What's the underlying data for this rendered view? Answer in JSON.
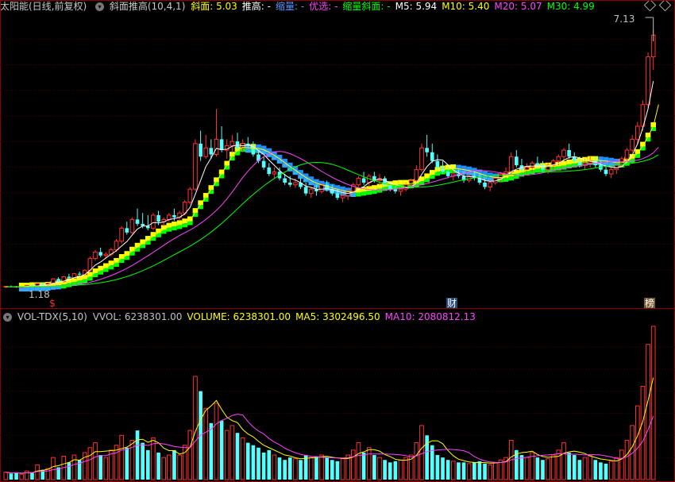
{
  "header": {
    "stock": "太阳能(日线,前复权)",
    "indicator": "斜面推高(10,4,1)",
    "items": [
      {
        "label": "斜面:",
        "value": "5.03",
        "color": "#ffff00"
      },
      {
        "label": "推高:",
        "value": "-",
        "color": "#ffffff"
      },
      {
        "label": "缩量:",
        "value": "-",
        "color": "#5599ff"
      },
      {
        "label": "优选:",
        "value": "-",
        "color": "#ff44ff"
      },
      {
        "label": "缩量斜面:",
        "value": "-",
        "color": "#00ff00"
      },
      {
        "label": "M5:",
        "value": "5.94",
        "color": "#ffffff"
      },
      {
        "label": "M10:",
        "value": "5.40",
        "color": "#ffff00"
      },
      {
        "label": "M20:",
        "value": "5.07",
        "color": "#ff44ff"
      },
      {
        "label": "M30:",
        "value": "4.99",
        "color": "#00ff00"
      }
    ]
  },
  "vol_header": {
    "name": "VOL-TDX(5,10)",
    "items": [
      {
        "label": "VVOL:",
        "value": "6238301.00",
        "color": "#c0c0c0"
      },
      {
        "label": "VOLUME:",
        "value": "6238301.00",
        "color": "#ffff00"
      },
      {
        "label": "MA5:",
        "value": "3302496.50",
        "color": "#ffff00"
      },
      {
        "label": "MA10:",
        "value": "2080812.13",
        "color": "#ff44ff"
      }
    ]
  },
  "markers": {
    "high_label": "7.13",
    "low_label": "1.18",
    "event_marks": [
      "$",
      "财",
      "榜"
    ]
  },
  "chart_data": {
    "type": "candlestick",
    "price_range": [
      1.0,
      7.5
    ],
    "candles": [
      [
        1.2,
        1.22,
        1.17,
        1.21
      ],
      [
        1.21,
        1.23,
        1.19,
        1.2
      ],
      [
        1.2,
        1.22,
        1.18,
        1.19
      ],
      [
        1.19,
        1.21,
        1.18,
        1.2
      ],
      [
        1.2,
        1.24,
        1.19,
        1.23
      ],
      [
        1.23,
        1.25,
        1.2,
        1.21
      ],
      [
        1.21,
        1.28,
        1.2,
        1.27
      ],
      [
        1.27,
        1.3,
        1.24,
        1.25
      ],
      [
        1.25,
        1.3,
        1.22,
        1.28
      ],
      [
        1.28,
        1.4,
        1.27,
        1.38
      ],
      [
        1.38,
        1.42,
        1.3,
        1.32
      ],
      [
        1.32,
        1.45,
        1.3,
        1.43
      ],
      [
        1.43,
        1.5,
        1.38,
        1.4
      ],
      [
        1.4,
        1.52,
        1.39,
        1.5
      ],
      [
        1.5,
        1.55,
        1.45,
        1.48
      ],
      [
        1.48,
        1.6,
        1.46,
        1.58
      ],
      [
        1.58,
        1.9,
        1.55,
        1.85
      ],
      [
        1.85,
        2.05,
        1.8,
        2.0
      ],
      [
        2.0,
        2.1,
        1.88,
        1.92
      ],
      [
        1.92,
        2.0,
        1.85,
        1.95
      ],
      [
        1.95,
        2.1,
        1.9,
        2.05
      ],
      [
        2.05,
        2.3,
        2.0,
        2.25
      ],
      [
        2.25,
        2.6,
        2.2,
        2.55
      ],
      [
        2.55,
        2.7,
        2.4,
        2.45
      ],
      [
        2.45,
        2.8,
        2.42,
        2.75
      ],
      [
        2.75,
        3.0,
        2.6,
        2.65
      ],
      [
        2.65,
        2.9,
        2.55,
        2.6
      ],
      [
        2.6,
        2.85,
        2.5,
        2.55
      ],
      [
        2.55,
        2.9,
        2.5,
        2.85
      ],
      [
        2.85,
        2.95,
        2.62,
        2.7
      ],
      [
        2.7,
        2.8,
        2.6,
        2.75
      ],
      [
        2.75,
        2.9,
        2.7,
        2.85
      ],
      [
        2.85,
        3.0,
        2.72,
        2.8
      ],
      [
        2.8,
        2.95,
        2.75,
        2.9
      ],
      [
        2.9,
        3.2,
        2.85,
        3.15
      ],
      [
        3.15,
        3.5,
        3.1,
        3.45
      ],
      [
        3.45,
        4.6,
        3.4,
        4.5
      ],
      [
        4.5,
        4.8,
        4.1,
        4.2
      ],
      [
        4.2,
        4.7,
        4.15,
        4.4
      ],
      [
        4.4,
        4.6,
        4.15,
        4.25
      ],
      [
        4.25,
        5.3,
        4.2,
        4.6
      ],
      [
        4.6,
        4.9,
        4.3,
        4.35
      ],
      [
        4.35,
        4.6,
        4.15,
        4.45
      ],
      [
        4.45,
        4.7,
        4.3,
        4.55
      ],
      [
        4.55,
        4.75,
        4.35,
        4.4
      ],
      [
        4.4,
        4.6,
        4.3,
        4.5
      ],
      [
        4.5,
        4.65,
        4.4,
        4.45
      ],
      [
        4.45,
        4.55,
        4.2,
        4.25
      ],
      [
        4.25,
        4.35,
        4.05,
        4.1
      ],
      [
        4.1,
        4.2,
        3.9,
        3.95
      ],
      [
        3.95,
        4.05,
        3.75,
        3.8
      ],
      [
        3.8,
        3.95,
        3.7,
        3.85
      ],
      [
        3.85,
        3.95,
        3.65,
        3.7
      ],
      [
        3.7,
        3.8,
        3.55,
        3.6
      ],
      [
        3.6,
        3.75,
        3.5,
        3.55
      ],
      [
        3.55,
        3.7,
        3.48,
        3.6
      ],
      [
        3.6,
        3.7,
        3.45,
        3.5
      ],
      [
        3.5,
        3.6,
        3.3,
        3.35
      ],
      [
        3.35,
        3.5,
        3.25,
        3.45
      ],
      [
        3.45,
        3.55,
        3.3,
        3.4
      ],
      [
        3.4,
        3.6,
        3.35,
        3.55
      ],
      [
        3.55,
        3.65,
        3.4,
        3.45
      ],
      [
        3.45,
        3.55,
        3.3,
        3.35
      ],
      [
        3.35,
        3.45,
        3.2,
        3.25
      ],
      [
        3.25,
        3.4,
        3.15,
        3.3
      ],
      [
        3.3,
        3.45,
        3.2,
        3.4
      ],
      [
        3.4,
        3.6,
        3.35,
        3.55
      ],
      [
        3.55,
        3.75,
        3.5,
        3.7
      ],
      [
        3.7,
        3.85,
        3.55,
        3.6
      ],
      [
        3.6,
        3.8,
        3.5,
        3.75
      ],
      [
        3.75,
        3.85,
        3.6,
        3.65
      ],
      [
        3.65,
        3.8,
        3.55,
        3.7
      ],
      [
        3.7,
        3.75,
        3.5,
        3.55
      ],
      [
        3.55,
        3.6,
        3.4,
        3.45
      ],
      [
        3.45,
        3.55,
        3.35,
        3.4
      ],
      [
        3.4,
        3.5,
        3.3,
        3.45
      ],
      [
        3.45,
        3.6,
        3.4,
        3.55
      ],
      [
        3.55,
        3.7,
        3.5,
        3.65
      ],
      [
        3.65,
        4.0,
        3.6,
        3.9
      ],
      [
        3.9,
        4.5,
        3.85,
        4.4
      ],
      [
        4.4,
        4.7,
        4.2,
        4.3
      ],
      [
        4.3,
        4.5,
        4.05,
        4.1
      ],
      [
        4.1,
        4.25,
        3.9,
        3.95
      ],
      [
        3.95,
        4.1,
        3.8,
        3.85
      ],
      [
        3.85,
        3.95,
        3.7,
        3.75
      ],
      [
        3.75,
        3.9,
        3.65,
        3.8
      ],
      [
        3.8,
        3.9,
        3.7,
        3.75
      ],
      [
        3.75,
        3.85,
        3.6,
        3.65
      ],
      [
        3.65,
        3.8,
        3.6,
        3.75
      ],
      [
        3.75,
        3.85,
        3.65,
        3.7
      ],
      [
        3.7,
        3.8,
        3.55,
        3.6
      ],
      [
        3.6,
        3.7,
        3.45,
        3.5
      ],
      [
        3.5,
        3.65,
        3.4,
        3.6
      ],
      [
        3.6,
        3.75,
        3.55,
        3.7
      ],
      [
        3.7,
        3.85,
        3.6,
        3.8
      ],
      [
        3.8,
        3.95,
        3.7,
        3.85
      ],
      [
        3.85,
        4.3,
        3.8,
        4.2
      ],
      [
        4.2,
        4.35,
        3.95,
        4.0
      ],
      [
        4.0,
        4.15,
        3.85,
        3.9
      ],
      [
        3.9,
        4.05,
        3.8,
        3.95
      ],
      [
        3.95,
        4.1,
        3.85,
        4.05
      ],
      [
        4.05,
        4.2,
        3.95,
        4.0
      ],
      [
        4.0,
        4.1,
        3.85,
        3.9
      ],
      [
        3.9,
        4.05,
        3.8,
        4.0
      ],
      [
        4.0,
        4.15,
        3.9,
        4.1
      ],
      [
        4.1,
        4.25,
        4.0,
        4.2
      ],
      [
        4.2,
        4.4,
        4.1,
        4.35
      ],
      [
        4.35,
        4.5,
        4.15,
        4.2
      ],
      [
        4.2,
        4.3,
        4.05,
        4.1
      ],
      [
        4.1,
        4.2,
        3.95,
        4.0
      ],
      [
        4.0,
        4.15,
        3.9,
        4.05
      ],
      [
        4.05,
        4.2,
        3.95,
        4.1
      ],
      [
        4.1,
        4.2,
        3.95,
        4.0
      ],
      [
        4.0,
        4.1,
        3.85,
        3.9
      ],
      [
        3.9,
        4.0,
        3.75,
        3.8
      ],
      [
        3.8,
        3.95,
        3.7,
        3.9
      ],
      [
        3.9,
        4.05,
        3.8,
        4.0
      ],
      [
        4.0,
        4.2,
        3.95,
        4.15
      ],
      [
        4.15,
        4.4,
        4.1,
        4.35
      ],
      [
        4.35,
        4.7,
        4.3,
        4.6
      ],
      [
        4.6,
        5.0,
        4.5,
        4.9
      ],
      [
        4.9,
        5.5,
        4.8,
        5.4
      ],
      [
        5.4,
        6.6,
        5.3,
        6.5
      ],
      [
        6.5,
        7.13,
        6.2,
        7.0
      ]
    ],
    "ma5": [
      1.2,
      1.2,
      1.2,
      1.2,
      1.21,
      1.21,
      1.22,
      1.23,
      1.25,
      1.28,
      1.3,
      1.33,
      1.36,
      1.41,
      1.43,
      1.48,
      1.58,
      1.7,
      1.77,
      1.86,
      1.95,
      2.03,
      2.14,
      2.24,
      2.39,
      2.53,
      2.6,
      2.6,
      2.68,
      2.67,
      2.69,
      2.75,
      2.77,
      2.8,
      2.88,
      3.03,
      3.33,
      3.65,
      3.97,
      4.17,
      4.39,
      4.36,
      4.37,
      4.44,
      4.47,
      4.45,
      4.47,
      4.43,
      4.34,
      4.25,
      4.12,
      4.0,
      3.88,
      3.78,
      3.7,
      3.66,
      3.6,
      3.52,
      3.49,
      3.45,
      3.45,
      3.46,
      3.44,
      3.41,
      3.37,
      3.35,
      3.38,
      3.44,
      3.51,
      3.6,
      3.65,
      3.68,
      3.65,
      3.6,
      3.55,
      3.52,
      3.48,
      3.5,
      3.59,
      3.79,
      3.97,
      4.09,
      4.13,
      4.12,
      4.01,
      3.89,
      3.82,
      3.75,
      3.74,
      3.73,
      3.7,
      3.65,
      3.63,
      3.64,
      3.68,
      3.75,
      3.85,
      3.91,
      3.95,
      3.98,
      3.98,
      3.98,
      3.98,
      3.99,
      4.01,
      4.04,
      4.12,
      4.18,
      4.2,
      4.17,
      4.13,
      4.09,
      4.08,
      4.02,
      3.98,
      3.96,
      3.94,
      3.97,
      4.08,
      4.24,
      4.49,
      4.86,
      5.3,
      5.94
    ],
    "ma10": [
      1.2,
      1.2,
      1.2,
      1.2,
      1.2,
      1.21,
      1.21,
      1.21,
      1.22,
      1.24,
      1.25,
      1.27,
      1.3,
      1.33,
      1.36,
      1.39,
      1.45,
      1.53,
      1.59,
      1.65,
      1.71,
      1.77,
      1.86,
      1.93,
      2.03,
      2.12,
      2.2,
      2.28,
      2.37,
      2.45,
      2.53,
      2.58,
      2.61,
      2.64,
      2.68,
      2.73,
      2.92,
      3.1,
      3.27,
      3.45,
      3.63,
      3.81,
      4.01,
      4.22,
      4.34,
      4.42,
      4.4,
      4.4,
      4.39,
      4.36,
      4.3,
      4.23,
      4.15,
      4.06,
      3.97,
      3.89,
      3.8,
      3.72,
      3.65,
      3.59,
      3.55,
      3.52,
      3.48,
      3.45,
      3.42,
      3.39,
      3.38,
      3.39,
      3.41,
      3.43,
      3.45,
      3.48,
      3.52,
      3.54,
      3.56,
      3.57,
      3.57,
      3.58,
      3.6,
      3.65,
      3.72,
      3.8,
      3.87,
      3.9,
      3.92,
      3.93,
      3.92,
      3.9,
      3.88,
      3.85,
      3.81,
      3.77,
      3.74,
      3.72,
      3.72,
      3.73,
      3.76,
      3.8,
      3.85,
      3.88,
      3.91,
      3.94,
      3.96,
      3.97,
      3.98,
      3.99,
      4.01,
      4.04,
      4.06,
      4.08,
      4.1,
      4.12,
      4.12,
      4.11,
      4.1,
      4.08,
      4.06,
      4.06,
      4.1,
      4.17,
      4.28,
      4.45,
      4.66,
      4.9,
      5.4
    ]
  },
  "volume_data": {
    "type": "bar",
    "vol_range": [
      0,
      6300000
    ],
    "values": [
      300000,
      250000,
      280000,
      220000,
      350000,
      300000,
      600000,
      400000,
      450000,
      900000,
      500000,
      950000,
      700000,
      1000000,
      800000,
      1100000,
      1300000,
      1500000,
      1000000,
      900000,
      1200000,
      1400000,
      1800000,
      1300000,
      1600000,
      2000000,
      1500000,
      1200000,
      1700000,
      1100000,
      900000,
      1000000,
      1200000,
      1000000,
      1400000,
      2000000,
      4200000,
      3600000,
      2900000,
      2300000,
      3100000,
      2400000,
      2000000,
      2200000,
      1900000,
      1700000,
      1500000,
      1400000,
      1300000,
      1100000,
      1200000,
      1000000,
      900000,
      800000,
      900000,
      850000,
      800000,
      1000000,
      900000,
      950000,
      1000000,
      900000,
      800000,
      750000,
      850000,
      1000000,
      1200000,
      1500000,
      1100000,
      1300000,
      1000000,
      900000,
      800000,
      700000,
      750000,
      800000,
      900000,
      1000000,
      1500000,
      2200000,
      1800000,
      1400000,
      1000000,
      900000,
      800000,
      750000,
      700000,
      700000,
      650000,
      700000,
      750000,
      650000,
      600000,
      700000,
      800000,
      900000,
      1600000,
      1200000,
      1000000,
      900000,
      1100000,
      900000,
      800000,
      850000,
      1000000,
      1200000,
      1500000,
      1100000,
      1000000,
      800000,
      900000,
      1000000,
      800000,
      700000,
      650000,
      750000,
      900000,
      1200000,
      1600000,
      2200000,
      3000000,
      3800000,
      5500000,
      6238301
    ]
  }
}
